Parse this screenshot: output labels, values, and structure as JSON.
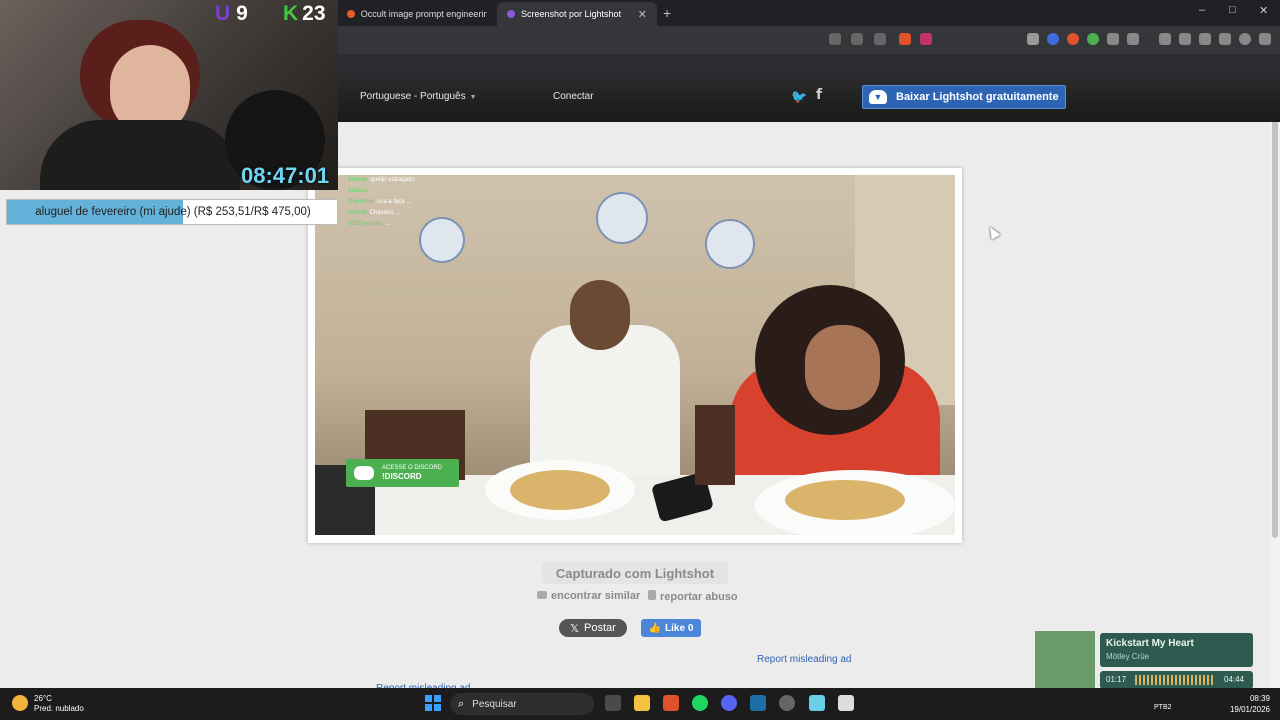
{
  "browser": {
    "tabs": [
      {
        "label": "Occult image prompt engineering fo",
        "active": false
      },
      {
        "label": "Screenshot por Lightshot",
        "active": true
      }
    ],
    "new_tab": "+",
    "window_controls": {
      "minimize": "–",
      "maximize": "□",
      "close": "✕"
    }
  },
  "site_header": {
    "language": "Portuguese - Português",
    "connect": "Conectar",
    "twitter_icon": "twitter-icon",
    "facebook_icon": "facebook-icon",
    "download_button": "Baixar Lightshot gratuitamente"
  },
  "screenshot": {
    "chat_overlay": [
      {
        "user": "fubaas",
        "message": "queijo estragado"
      },
      {
        "user": "fubaas",
        "message": ""
      },
      {
        "user": "Cantinho",
        "message": "usa a faca ..."
      },
      {
        "user": "citakal",
        "message": "Chaveiro ..."
      },
      {
        "user": "a157morrao",
        "message": "..."
      }
    ],
    "discord_line1": "ACESSE O DISCORD",
    "discord_line2": "!DISCORD"
  },
  "captions": {
    "captured_with": "Capturado com Lightshot",
    "find_similar": "encontrar similar",
    "report_abuse": "reportar abuso",
    "x_post": "Postar",
    "fb_like": "Like 0",
    "report_ad": "Report misleading ad",
    "report_ad_2": "Report misleading ad"
  },
  "stream_overlay": {
    "counter_1": "9",
    "counter_2": "23",
    "timer": "08:47:01",
    "goal_text": "aluguel de fevereiro (mi ajude) (R$ 253,51/R$ 475,00)",
    "goal_progress": 0.534
  },
  "now_playing": {
    "title": "Kickstart My Heart",
    "artist": "Mötley Crüe",
    "elapsed": "01:17",
    "duration": "04:44"
  },
  "taskbar": {
    "weather_temp": "26°C",
    "weather_desc": "Pred. nublado",
    "search_placeholder": "Pesquisar",
    "keyboard_lang": "PTB2",
    "time": "08:39",
    "date": "19/01/2026"
  },
  "colors": {
    "download_button_bg": "#2d64b4",
    "timer": "#6ed6f2",
    "goal_fill": "#64b2d9",
    "music_panel": "#2f5a4f"
  }
}
